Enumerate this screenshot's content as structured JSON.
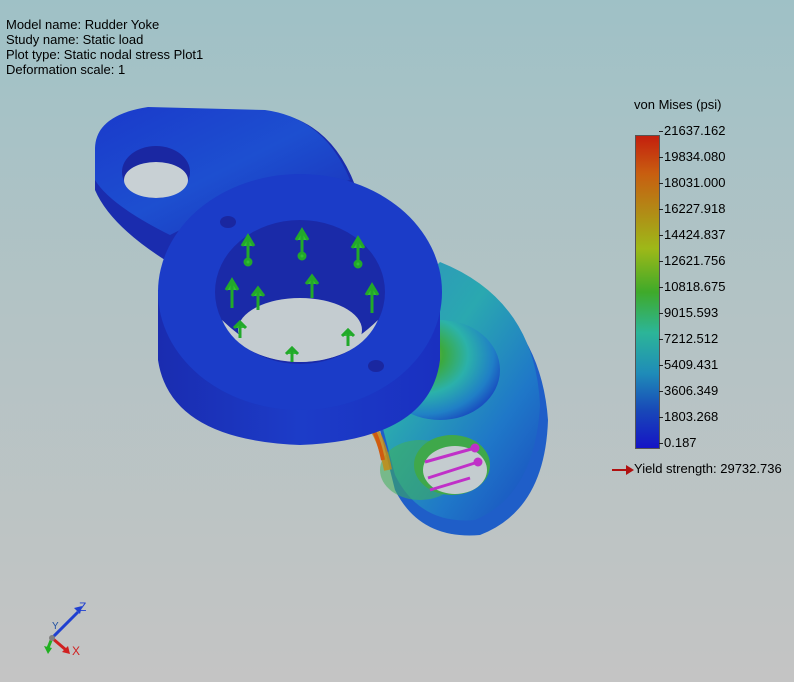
{
  "info": {
    "model_name": "Model name: Rudder Yoke",
    "study_name": "Study name: Static load",
    "plot_type": "Plot type: Static nodal stress Plot1",
    "deformation_scale": "Deformation scale: 1"
  },
  "legend": {
    "title": "von Mises (psi)",
    "ticks": [
      "21637.162",
      "19834.080",
      "18031.000",
      "16227.918",
      "14424.837",
      "12621.756",
      "10818.675",
      "9015.593",
      "7212.512",
      "5409.431",
      "3606.349",
      "1803.268",
      "0.187"
    ],
    "yield_label": "Yield strength: 29732.736",
    "colors": [
      "#c41f0e",
      "#c85e10",
      "#b28a16",
      "#9eb818",
      "#3faa2a",
      "#2cb598",
      "#1f8cb8",
      "#1848b8",
      "#1514c6"
    ]
  },
  "triad": {
    "x_label": "X",
    "y_label": "Y",
    "z_label": "Z"
  },
  "icons": [
    "load-arrow-icon",
    "fixture-arrow-icon",
    "coordinate-triad-icon"
  ]
}
